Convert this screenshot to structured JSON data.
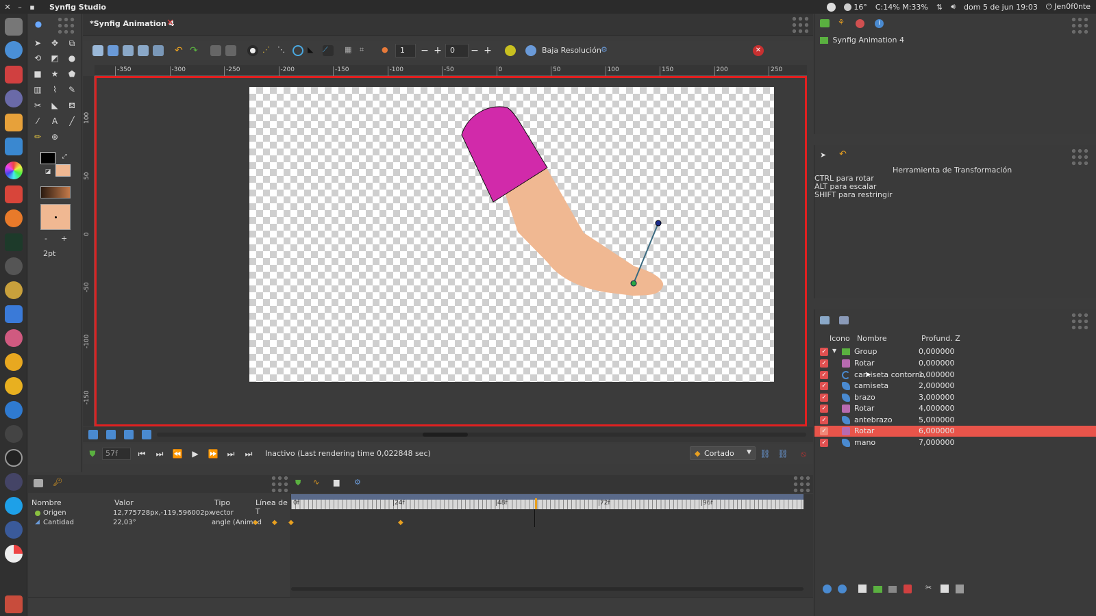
{
  "system": {
    "app_title": "Synfig Studio",
    "weather": "16°",
    "cpu_mem": "C:14% M:33%",
    "datetime": "dom 5 de jun 19:03",
    "user": "Jen0f0nte"
  },
  "document": {
    "tab_title": "*Synfig Animation 4"
  },
  "toolbar": {
    "frame_value": "1",
    "offset_value": "0",
    "low_res_label": "Baja Resolución"
  },
  "rulers": {
    "h_labels": [
      "-350",
      "-300",
      "-250",
      "-200",
      "-150",
      "-100",
      "-50",
      "0",
      "50",
      "100",
      "150",
      "200",
      "250"
    ],
    "v_labels": [
      "100",
      "50",
      "0",
      "-50",
      "-100",
      "-150"
    ]
  },
  "toolbox": {
    "brush_size": "2pt",
    "minus": "-",
    "plus": "+"
  },
  "playback": {
    "current_time": "57f",
    "status": "Inactivo (Last rendering time 0,022848 sec)",
    "interpolation": "Cortado"
  },
  "params": {
    "headers": {
      "name": "Nombre",
      "value": "Valor",
      "type": "Tipo",
      "timeline": "Línea de T"
    },
    "rows": [
      {
        "name": "Origen",
        "value": "12,775728px,-119,596002px",
        "type": "vector"
      },
      {
        "name": "Cantidad",
        "value": "22,03°",
        "type": "angle (Animad"
      }
    ]
  },
  "timeline": {
    "marks": [
      "0f",
      "|24f",
      "|48f",
      "|72f",
      "|96f"
    ]
  },
  "canvas_browser": {
    "item": "Synfig Animation 4"
  },
  "tool_options": {
    "title": "Herramienta de Transformación",
    "hints": [
      "CTRL para rotar",
      "ALT para escalar",
      "SHIFT para restringir"
    ]
  },
  "layers": {
    "headers": {
      "icon": "Icono",
      "name": "Nombre",
      "z": "Profund. Z"
    },
    "rows": [
      {
        "name": "Group",
        "z": "0,000000",
        "kind": "group"
      },
      {
        "name": "Rotar",
        "z": "0,000000",
        "kind": "rotate"
      },
      {
        "name": "camiseta contorno",
        "z": "1,000000",
        "kind": "outline"
      },
      {
        "name": "camiseta",
        "z": "2,000000",
        "kind": "region"
      },
      {
        "name": "brazo",
        "z": "3,000000",
        "kind": "region"
      },
      {
        "name": "Rotar",
        "z": "4,000000",
        "kind": "rotate"
      },
      {
        "name": "antebrazo",
        "z": "5,000000",
        "kind": "region"
      },
      {
        "name": "Rotar",
        "z": "6,000000",
        "kind": "rotate",
        "selected": true
      },
      {
        "name": "mano",
        "z": "7,000000",
        "kind": "region"
      }
    ]
  },
  "colors": {
    "accent_red": "#e02020",
    "selection": "#e8544a",
    "shirt": "#d12aaa",
    "skin": "#f0b892"
  }
}
